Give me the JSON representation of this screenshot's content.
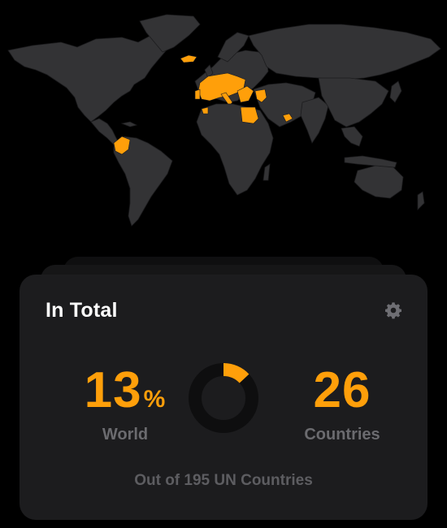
{
  "map": {
    "land_color": "#333335",
    "visited_color": "#ff9f0a"
  },
  "card": {
    "title": "In Total",
    "settings_icon": "gear-icon",
    "world_stat": {
      "value": "13",
      "unit": "%",
      "label": "World",
      "fraction": 0.13
    },
    "countries_stat": {
      "value": "26",
      "label": "Countries"
    },
    "footer": "Out of 195 UN Countries"
  },
  "colors": {
    "accent": "#ff9f0a",
    "card_bg": "#1c1c1e",
    "label_gray": "#6b6b6f",
    "ring_track": "#0e0e0f"
  }
}
